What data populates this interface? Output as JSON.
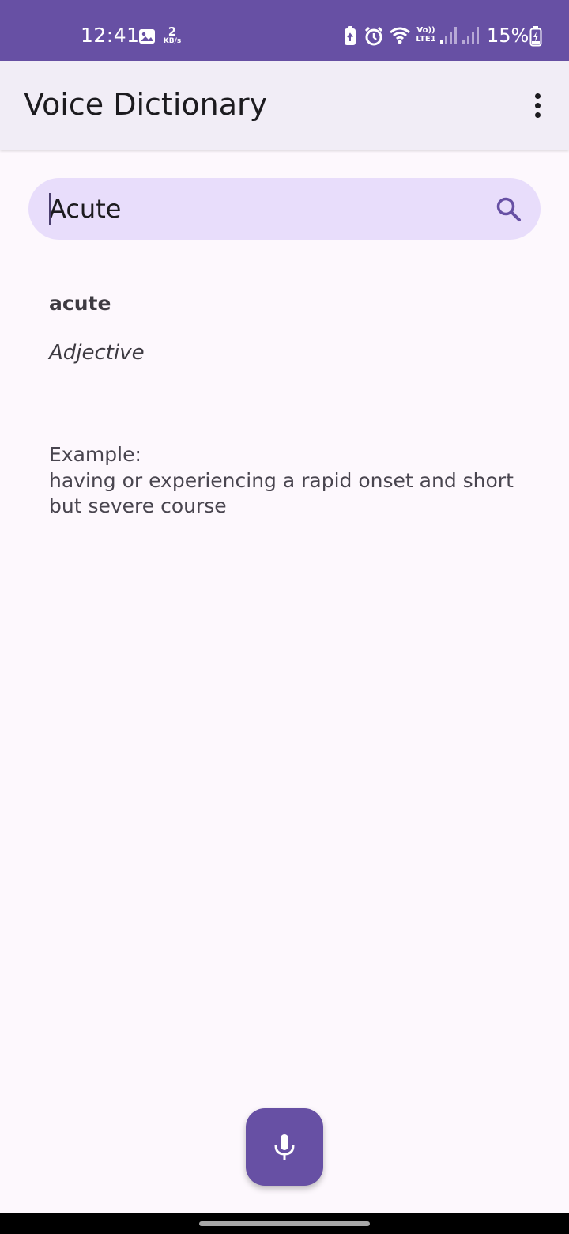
{
  "status_bar": {
    "time": "12:41",
    "net_speed_value": "2",
    "net_speed_unit": "KB/s",
    "volte_label": "Vo)) LTE1",
    "battery_percent": "15%"
  },
  "app_bar": {
    "title": "Voice Dictionary"
  },
  "search": {
    "value": "Acute"
  },
  "result": {
    "word": "acute",
    "part_of_speech": "Adjective",
    "example_label": "Example:",
    "definition": "having or experiencing a rapid onset and short but severe course"
  },
  "colors": {
    "primary": "#6750a4",
    "app_bar_bg": "#f1edf6",
    "search_bg": "#e8ddfb",
    "page_bg": "#fdf8fd"
  },
  "icons": {
    "search": "search-icon",
    "mic": "microphone-icon",
    "menu": "more-vert-icon"
  }
}
